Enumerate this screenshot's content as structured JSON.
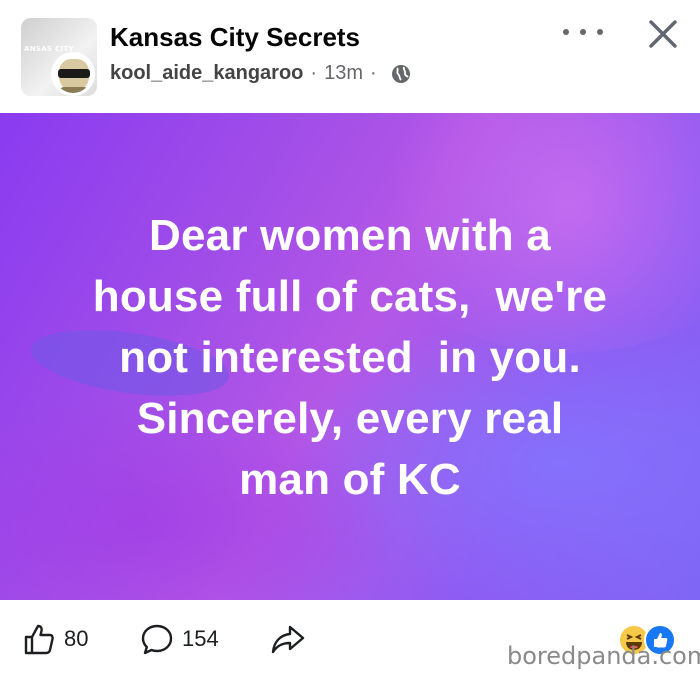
{
  "header": {
    "group_name": "Kansas City Secrets",
    "group_avatar_tag": "ANSAS CITY",
    "author": "kool_aide_kangaroo",
    "separator": "·",
    "time": "13m",
    "privacy_icon": "globe-icon",
    "more_icon": "more-dots-icon",
    "close_icon": "close-icon"
  },
  "post": {
    "text": "Dear women with a house full of cats, we're not interested in you. Sincerely, every real man of KC",
    "lines": [
      "Dear women with a",
      "house full of cats,  we're",
      "not interested  in you.",
      "Sincerely, every real",
      "man of KC"
    ],
    "text_color": "#ffffff",
    "background_colors": [
      "#8a3bf0",
      "#b457e6",
      "#7f66f5"
    ]
  },
  "footer": {
    "like_count": "80",
    "comment_count": "154",
    "like_icon": "thumbs-up-icon",
    "comment_icon": "comment-bubble-icon",
    "share_icon": "share-arrow-icon",
    "reactions": [
      "haha-reaction-icon",
      "like-reaction-icon"
    ]
  },
  "watermark": "boredpanda.com",
  "colors": {
    "secondary_text": "#65676b",
    "like_blue": "#1877f2"
  }
}
